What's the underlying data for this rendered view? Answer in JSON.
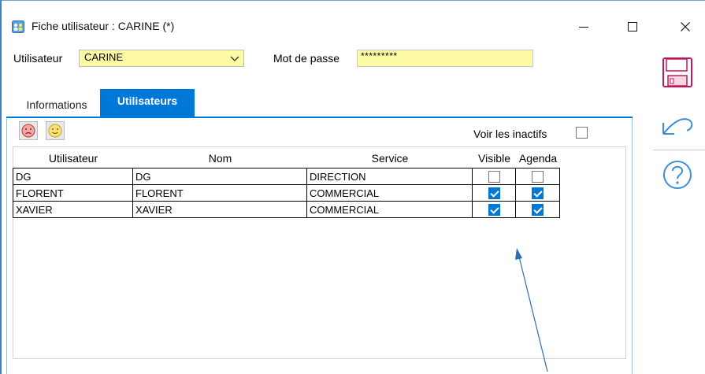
{
  "window": {
    "title": "Fiche utilisateur : CARINE (*)",
    "accent_color": "#0078d7"
  },
  "form": {
    "user_label": "Utilisateur",
    "user_value": "CARINE",
    "password_label": "Mot de passe",
    "password_value": "*********"
  },
  "tabs": [
    {
      "label": "Informations",
      "active": false
    },
    {
      "label": "Utilisateurs",
      "active": true
    }
  ],
  "toolbar": {
    "sad_icon": "sad-face-icon",
    "happy_icon": "smiley-face-icon",
    "show_inactive_label": "Voir les inactifs",
    "show_inactive_checked": false
  },
  "grid": {
    "headers": [
      "Utilisateur",
      "Nom",
      "Service",
      "Visible",
      "Agenda"
    ],
    "rows": [
      {
        "utilisateur": "DG",
        "nom": "DG",
        "service": "DIRECTION",
        "visible": false,
        "agenda": false
      },
      {
        "utilisateur": "FLORENT",
        "nom": "FLORENT",
        "service": "COMMERCIAL",
        "visible": true,
        "agenda": true
      },
      {
        "utilisateur": "XAVIER",
        "nom": "XAVIER",
        "service": "COMMERCIAL",
        "visible": true,
        "agenda": true
      }
    ]
  },
  "side_actions": [
    "save-icon",
    "undo-icon",
    "help-icon"
  ]
}
